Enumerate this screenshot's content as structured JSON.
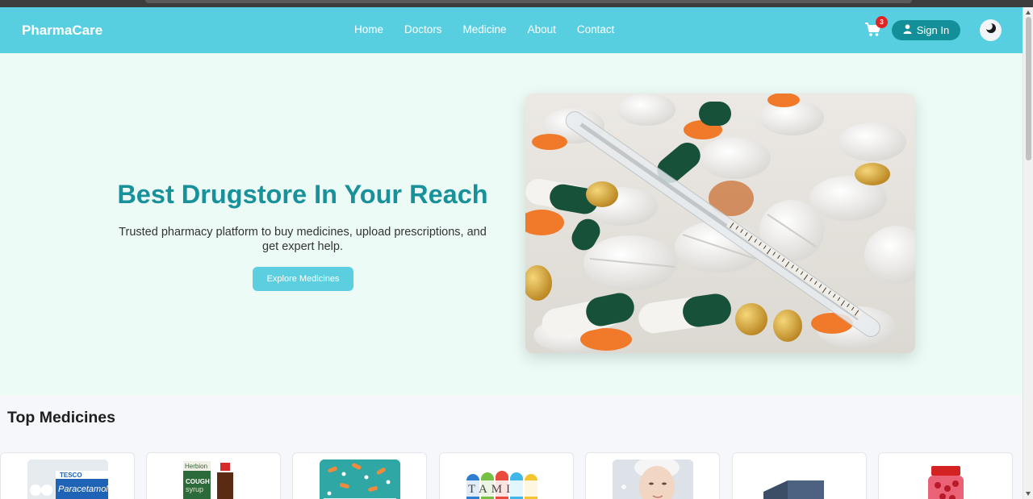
{
  "nav": {
    "brand": "PharmaCare",
    "links": [
      "Home",
      "Doctors",
      "Medicine",
      "About",
      "Contact"
    ],
    "cart_count": "3",
    "signin_label": "Sign In"
  },
  "hero": {
    "title": "Best Drugstore In Your Reach",
    "subtitle": "Trusted pharmacy platform to buy medicines, upload prescriptions, and get expert help.",
    "button_label": "Explore Medicines"
  },
  "top_medicines": {
    "title": "Top Medicines",
    "cards": [
      {
        "name": "paracetamol",
        "label": "Paracetamol",
        "brand": "TESCO"
      },
      {
        "name": "cough-syrup",
        "label": "COUGH syrup",
        "brand": "Herbion"
      },
      {
        "name": "capsules",
        "label": ""
      },
      {
        "name": "vitamins",
        "label": "TAMI"
      },
      {
        "name": "skincare",
        "label": ""
      },
      {
        "name": "inhaler",
        "label": ""
      },
      {
        "name": "supplement-bottle",
        "label": ""
      }
    ]
  },
  "colors": {
    "navbar": "#58cfe0",
    "accent": "#18919b",
    "signin": "#138f9a",
    "hero_bg": "#edfbf6",
    "badge": "#e02424"
  }
}
